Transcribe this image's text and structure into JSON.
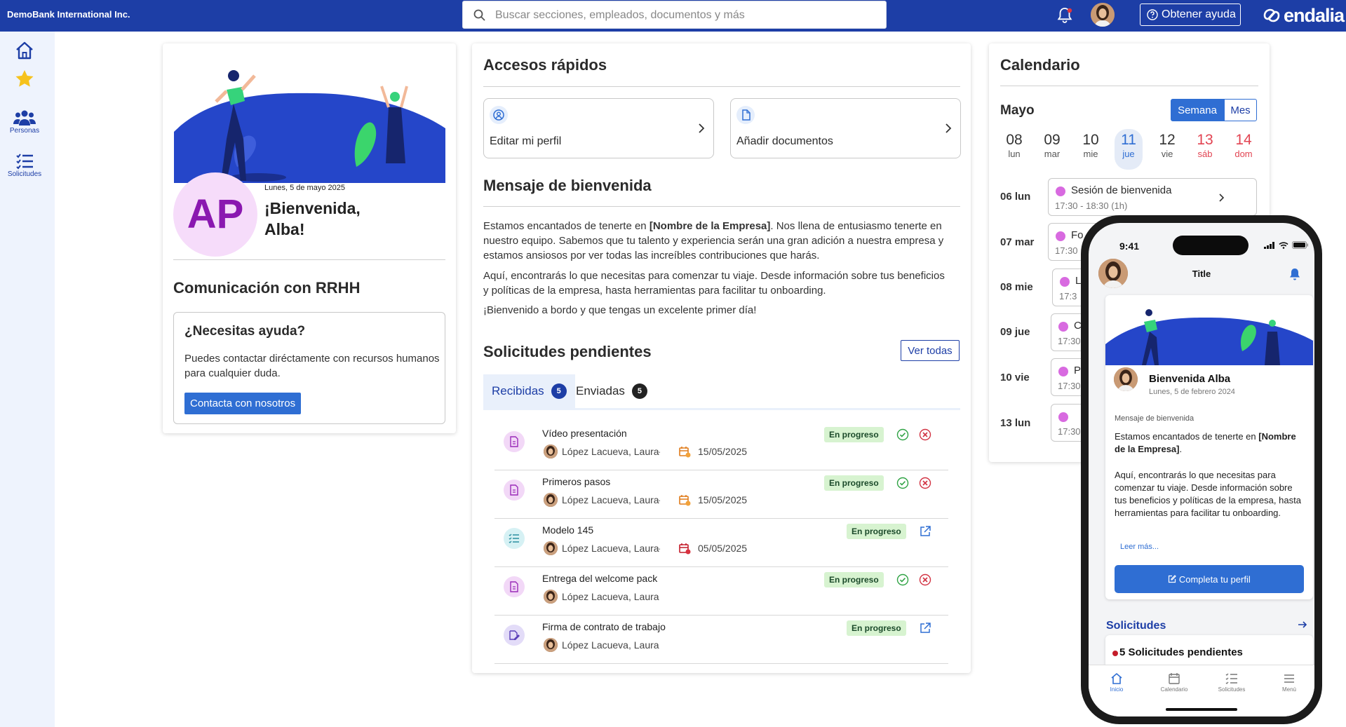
{
  "topbar": {
    "company": "DemoBank International Inc.",
    "search_placeholder": "Buscar secciones, empleados, documentos y más",
    "help_label": "Obtener ayuda",
    "logo_text": "endalia"
  },
  "sidebar": {
    "items": [
      {
        "label": "",
        "icon": "home-icon"
      },
      {
        "label": "",
        "icon": "star-icon"
      },
      {
        "label": "Personas",
        "icon": "people-icon"
      },
      {
        "label": "Solicitudes",
        "icon": "checklist-icon"
      }
    ]
  },
  "welcome": {
    "initials": "AP",
    "date": "Lunes, 5 de mayo 2025",
    "greeting": "¡Bienvenida, Alba!",
    "hr_title": "Comunicación con RRHH",
    "help_title": "¿Necesitas ayuda?",
    "help_body": "Puedes contactar diréctamente con recursos humanos para cualquier duda.",
    "contact_button": "Contacta con nosotros"
  },
  "quick_access": {
    "title": "Accesos rápidos",
    "items": [
      {
        "label": "Editar mi perfil",
        "icon": "user-circle-icon"
      },
      {
        "label": "Añadir documentos",
        "icon": "document-icon"
      }
    ]
  },
  "welcome_message": {
    "title": "Mensaje de bienvenida",
    "p1_before": "Estamos encantados de tenerte en ",
    "p1_bold": "[Nombre de la Empresa]",
    "p1_after": ". Nos llena de entusiasmo tenerte en nuestro equipo. Sabemos que tu talento y experiencia serán una gran adición a nuestra empresa y estamos ansiosos por ver todas las increíbles contribuciones que harás.",
    "p2": "Aquí, encontrarás lo que necesitas para comenzar tu viaje. Desde información sobre tus beneficios y políticas de la empresa, hasta herramientas para facilitar tu onboarding.",
    "p3": "¡Bienvenido a bordo y que tengas un excelente primer día!"
  },
  "requests": {
    "title": "Solicitudes pendientes",
    "view_all": "Ver todas",
    "tabs": [
      {
        "label": "Recibidas",
        "count": "5"
      },
      {
        "label": "Enviadas",
        "count": "5"
      }
    ],
    "rows": [
      {
        "title": "Vídeo presentación",
        "person": "López Lacueva, Laura",
        "date": "15/05/2025",
        "status": "En progreso",
        "icon": "document-icon",
        "actions": "approve-reject"
      },
      {
        "title": "Primeros pasos",
        "person": "López Lacueva, Laura",
        "date": "15/05/2025",
        "status": "En progreso",
        "icon": "document-icon",
        "actions": "approve-reject"
      },
      {
        "title": "Modelo 145",
        "person": "López Lacueva, Laura",
        "date": "05/05/2025",
        "status": "En progreso",
        "icon": "checklist-icon",
        "actions": "open"
      },
      {
        "title": "Entrega del welcome pack",
        "person": "López Lacueva, Laura",
        "date": "",
        "status": "En progreso",
        "icon": "document-icon",
        "actions": "approve-reject"
      },
      {
        "title": "Firma de contrato de trabajo",
        "person": "López Lacueva, Laura",
        "date": "",
        "status": "En progreso",
        "icon": "signature-icon",
        "actions": "open"
      }
    ]
  },
  "calendar": {
    "title": "Calendario",
    "month": "Mayo",
    "view_week": "Semana",
    "view_month": "Mes",
    "days": [
      {
        "num": "08",
        "name": "lun"
      },
      {
        "num": "09",
        "name": "mar"
      },
      {
        "num": "10",
        "name": "mie"
      },
      {
        "num": "11",
        "name": "jue"
      },
      {
        "num": "12",
        "name": "vie"
      },
      {
        "num": "13",
        "name": "sáb"
      },
      {
        "num": "14",
        "name": "dom"
      }
    ],
    "event_days": [
      {
        "label": "06 lun",
        "event": "Sesión de bienvenida",
        "time": "17:30 - 18:30 (1h)"
      },
      {
        "label": "07 mar",
        "event": "Fo",
        "time": "17:30"
      },
      {
        "label": "08 mie",
        "event": "L",
        "time": "17:3"
      },
      {
        "label": "09 jue",
        "event": "C",
        "time": "17:30"
      },
      {
        "label": "10 vie",
        "event": "P",
        "time": "17:30"
      },
      {
        "label": "13 lun",
        "event": "",
        "time": "17:30"
      }
    ]
  },
  "phone": {
    "time": "9:41",
    "title": "Title",
    "name": "Bienvenida Alba",
    "date": "Lunes, 5 de febrero 2024",
    "msg_header": "Mensaje de bienvenida",
    "msg1_before": "Estamos encantados de tenerte en ",
    "msg1_bold": "[Nombre de la Empresa]",
    "msg1_after": ".",
    "msg2": "Aquí, encontrarás lo que necesitas para comenzar tu viaje. Desde información sobre tus beneficios y políticas de la empresa, hasta  herramientas para facilitar tu onboarding.",
    "read_more": "Leer más...",
    "profile_button": "Completa tu perfil",
    "requests_title": "Solicitudes",
    "pending": "5 Solicitudes pendientes",
    "nav": [
      "Inicio",
      "Calendario",
      "Solicitudes",
      "Menú"
    ]
  },
  "colors": {
    "brand": "#1d3ea6",
    "accent": "#2f6ed3",
    "badge_bg": "#d7f3d0",
    "weekend": "#e24452",
    "event_dot": "#d86ae0"
  }
}
